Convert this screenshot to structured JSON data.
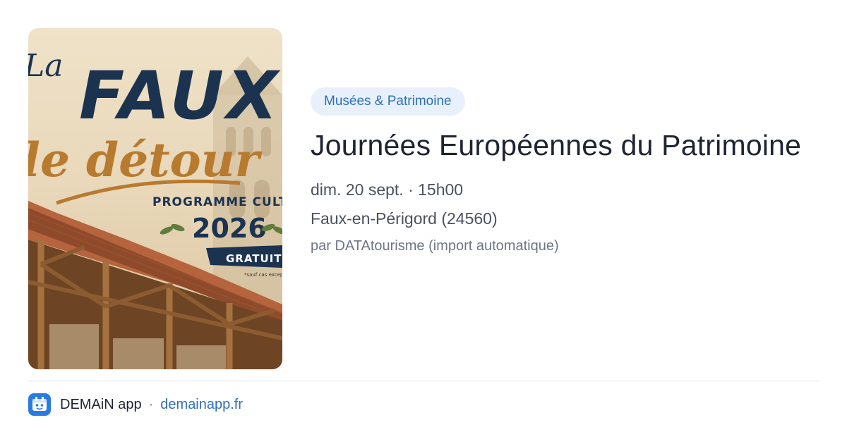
{
  "poster": {
    "title_prefix": "La",
    "title_main": "FAUX",
    "title_sub": "le détour",
    "program": "PROGRAMME CULTUREL",
    "year": "2026",
    "free": "GRATUIT*",
    "note": "*sauf cas exceptionnels"
  },
  "event": {
    "category": "Musées & Patrimoine",
    "title": "Journées Européennes du Patrimoine",
    "datetime": "dim. 20 sept. · 15h00",
    "location": "Faux-en-Périgord (24560)",
    "source": "par DATAtourisme (import automatique)"
  },
  "footer": {
    "app_name": "DEMAiN app",
    "separator": "·",
    "domain": "demainapp.fr"
  },
  "colors": {
    "accent": "#2f6fb8",
    "chip_bg": "#e8f1fb",
    "title_text": "#1e2432",
    "poster_navy": "#1c3350",
    "poster_gold": "#b87a2e"
  },
  "icons": {
    "app": "demain-app-icon"
  }
}
